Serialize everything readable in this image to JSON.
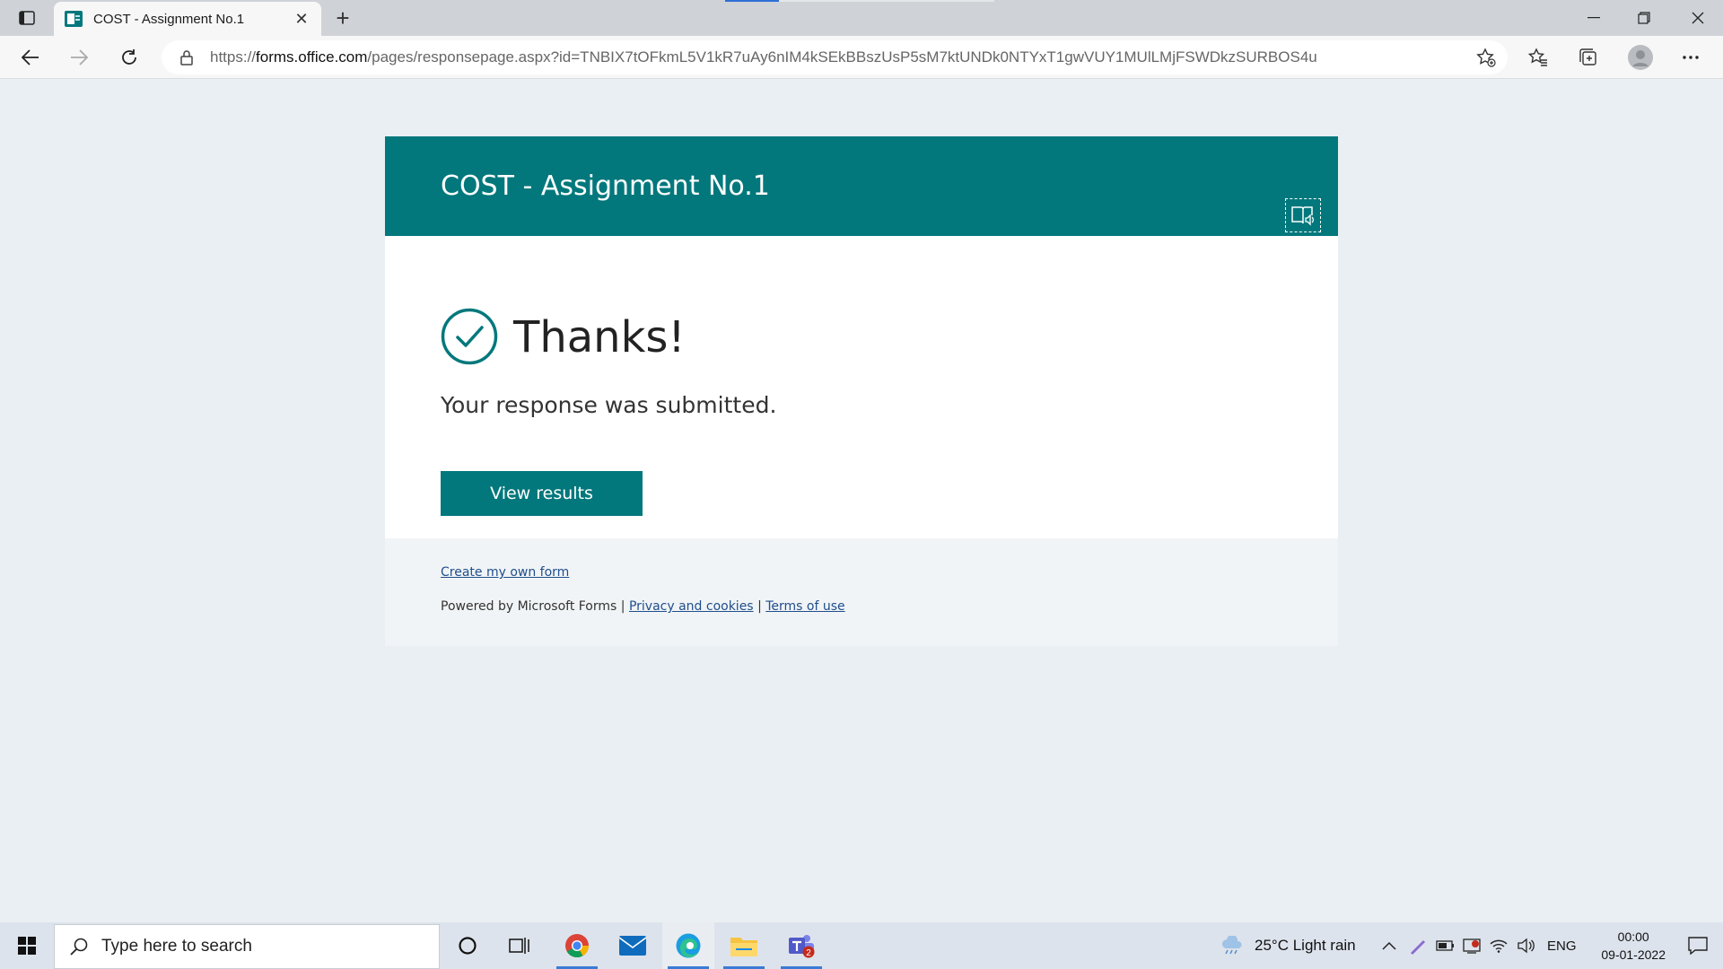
{
  "browser": {
    "tab_title": "COST - Assignment No.1",
    "url_prefix": "https://",
    "url_host": "forms.office.com",
    "url_rest": "/pages/responsepage.aspx?id=TNBIX7tOFkmL5V1kR7uAy6nIM4kSEkBBszUsP5sM7ktUNDk0NTYxT1gwVUY1MUlLMjFSWDkzSURBOS4u"
  },
  "form": {
    "title": "COST - Assignment No.1",
    "thanks": "Thanks!",
    "response_message": "Your response was submitted.",
    "view_results_label": "View results"
  },
  "footer": {
    "create_link": "Create my own form",
    "powered_by": "Powered by Microsoft Forms |",
    "privacy_link": "Privacy and cookies",
    "separator": "|",
    "terms_link": "Terms of use"
  },
  "taskbar": {
    "search_placeholder": "Type here to search",
    "weather": "25°C  Light rain",
    "language": "ENG",
    "time": "00:00",
    "date": "09-01-2022",
    "teams_badge": "2"
  },
  "colors": {
    "accent": "#03787c",
    "link": "#1f4e8c",
    "page_bg": "#e9eff3"
  }
}
